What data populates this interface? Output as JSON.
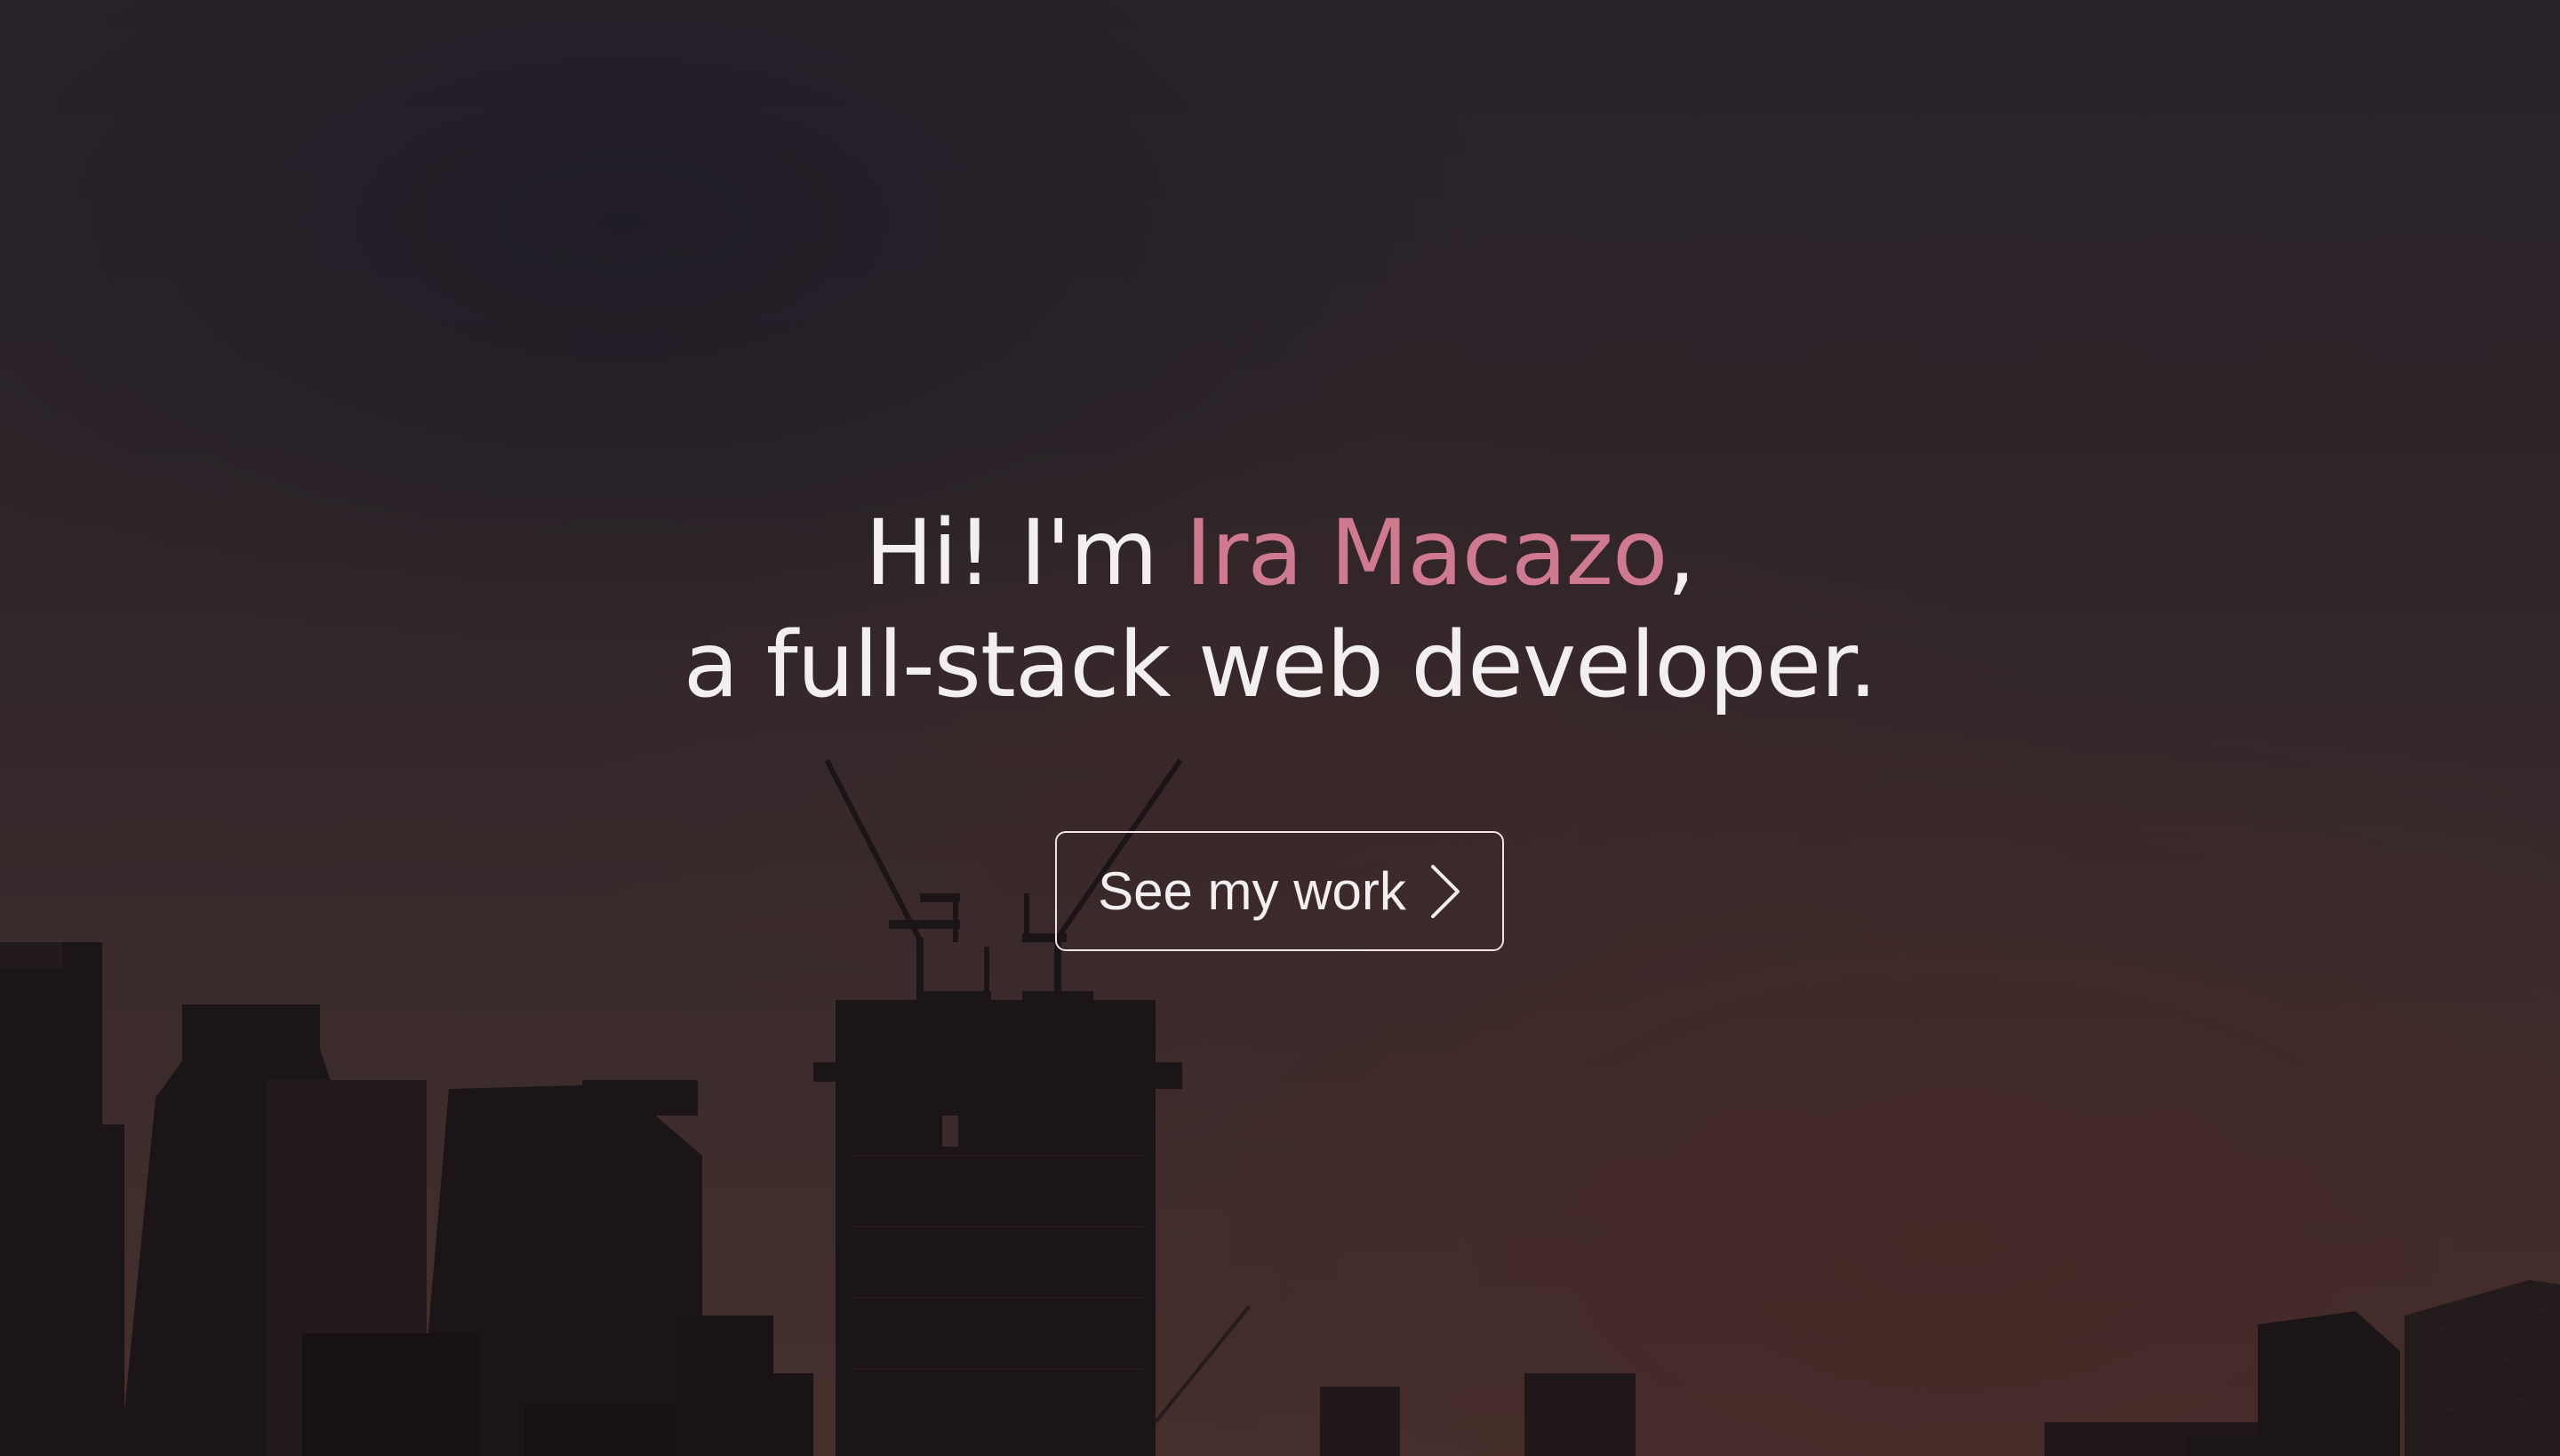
{
  "hero": {
    "greeting": "Hi! I'm ",
    "name": "Ira Macazo",
    "comma": ",",
    "tagline": "a full-stack web developer.",
    "cta_label": "See my work",
    "cta_icon": "chevron-right-icon"
  },
  "colors": {
    "accent": "#d07a91",
    "text": "#f3eef0",
    "background": "#2e2529"
  }
}
